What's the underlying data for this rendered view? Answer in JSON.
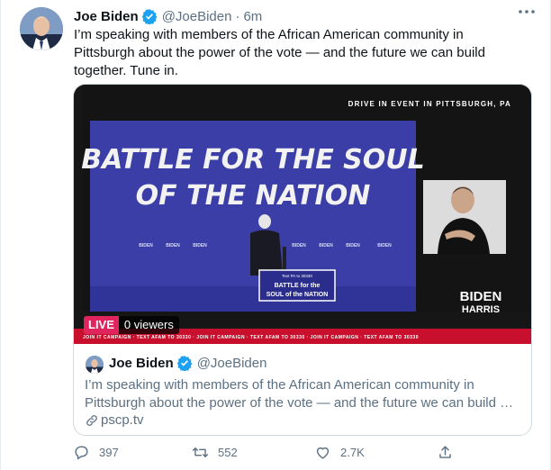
{
  "tweet": {
    "author_name": "Joe Biden",
    "author_handle": "@JoeBiden",
    "separator": "·",
    "time": "6m",
    "more_icon": "more-horizontal-icon",
    "text": "I’m speaking with members of the African American community in Pittsburgh about the power of the vote — and the future we can build together. Tune in."
  },
  "video": {
    "event_caption": "DRIVE IN EVENT IN PITTSBURGH, PA",
    "screen_line1": "BATTLE FOR THE SOUL",
    "screen_line2": "OF THE NATION",
    "logo_top": "BIDEN",
    "logo_bottom": "HARRIS",
    "podium_small": "Text PA to 30330",
    "podium_line1": "BATTLE for the",
    "podium_line2": "SOUL of the NATION",
    "banner_text": "JOIN IT CAMPAIGN · TEXT AFAM TO 30330 · JOIN IT CAMPAIGN · TEXT AFAM TO 30330 · JOIN IT CAMPAIGN · TEXT AFAM TO 30330",
    "live_label": "LIVE",
    "viewers_label": "0 viewers"
  },
  "card": {
    "author_name": "Joe Biden",
    "author_handle": "@JoeBiden",
    "text": "I’m speaking with members of the African American community in Pittsburgh about the power of the vote — and the future we can build …",
    "link": "pscp.tv"
  },
  "actions": {
    "reply_count": "397",
    "retweet_count": "552",
    "like_count": "2.7K"
  },
  "colors": {
    "verified_blue": "#1da1f2",
    "live_red": "#e0245e",
    "stage_purple": "#3b3ea6",
    "secondary_text": "#5b7083"
  }
}
